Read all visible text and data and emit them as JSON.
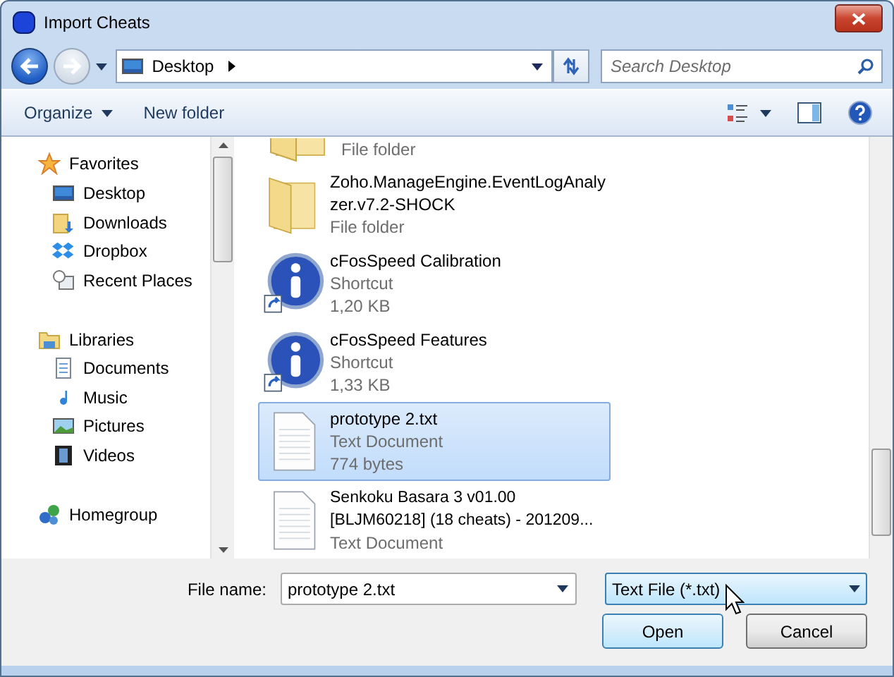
{
  "window": {
    "title": "Import Cheats"
  },
  "address": {
    "location": "Desktop"
  },
  "search": {
    "placeholder": "Search Desktop"
  },
  "toolbar": {
    "buttons": [
      {
        "label": "Organize",
        "dropdown": true
      },
      {
        "label": "New folder",
        "dropdown": false
      }
    ]
  },
  "sidebar": {
    "groups": [
      {
        "label": "Favorites",
        "kind": "star",
        "children": [
          {
            "label": "Desktop",
            "kind": "desktop",
            "selected": false
          },
          {
            "label": "Downloads",
            "kind": "downloads",
            "selected": false
          },
          {
            "label": "Dropbox",
            "kind": "dropbox",
            "selected": false
          },
          {
            "label": "Recent Places",
            "kind": "recent",
            "selected": false
          }
        ]
      },
      {
        "label": "Libraries",
        "kind": "library",
        "children": [
          {
            "label": "Documents",
            "kind": "documents",
            "selected": false
          },
          {
            "label": "Music",
            "kind": "music",
            "selected": false
          },
          {
            "label": "Pictures",
            "kind": "pictures",
            "selected": false
          },
          {
            "label": "Videos",
            "kind": "videos",
            "selected": false
          }
        ]
      },
      {
        "label": "Homegroup",
        "kind": "homegroup"
      }
    ]
  },
  "files": [
    {
      "kind": "folder",
      "type": "File folder",
      "selected": false
    },
    {
      "kind": "folder",
      "name": "Zoho.ManageEngine.EventLogAnalyzer.v7.2-SHOCK",
      "type": "File folder",
      "selected": false
    },
    {
      "kind": "shortcut",
      "name": "cFosSpeed Calibration",
      "type": "Shortcut",
      "size": "1,20 KB",
      "selected": false
    },
    {
      "kind": "shortcut",
      "name": "cFosSpeed Features",
      "type": "Shortcut",
      "size": "1,33 KB",
      "selected": false
    },
    {
      "kind": "text",
      "name": "prototype 2.txt",
      "type": "Text Document",
      "size": "774 bytes",
      "selected": true
    },
    {
      "kind": "text",
      "name": "Senkoku Basara 3 v01.00 [BLJM60218] (18 cheats) - 201209...",
      "type": "Text Document",
      "selected": false
    }
  ],
  "file_name": {
    "label": "File name:",
    "value": "prototype 2.txt"
  },
  "file_type": {
    "value": "Text File (*.txt)",
    "hovered": true
  },
  "buttons": [
    {
      "label": "Open",
      "default": true
    },
    {
      "label": "Cancel",
      "default": false
    }
  ]
}
